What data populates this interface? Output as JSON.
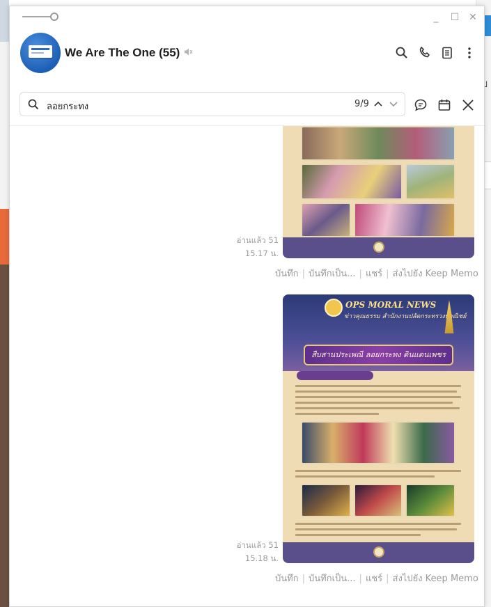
{
  "window": {
    "controls": {
      "minimize": "_",
      "maximize": "☐",
      "close": "✕"
    }
  },
  "chat": {
    "title": "We Are The One (55)"
  },
  "search": {
    "query": "ลอยกระทง",
    "count": "9/9"
  },
  "messages": [
    {
      "read_label": "อ่านแล้ว 51",
      "time": "15.17 น.",
      "actions": [
        "บันทึก",
        "บันทึกเป็น...",
        "แชร์",
        "ส่งไปยัง Keep Memo"
      ]
    },
    {
      "read_label": "อ่านแล้ว 51",
      "time": "15.18 น.",
      "poster": {
        "title": "OPS MORAL NEWS",
        "subtitle": "ข่าวคุณธรรม สำนักงานปลัดกระทรวงพาณิชย์",
        "ribbon": "สืบสานประเพณี ลอยกระทง ดินแดนเพชร"
      },
      "actions": [
        "บันทึก",
        "บันทึกเป็น...",
        "แชร์",
        "ส่งไปยัง Keep Memo"
      ]
    }
  ],
  "colors": {
    "accent": "#5a4f8a",
    "poster_frame": "#efdcb4",
    "muted_text": "#9a9a9a"
  }
}
